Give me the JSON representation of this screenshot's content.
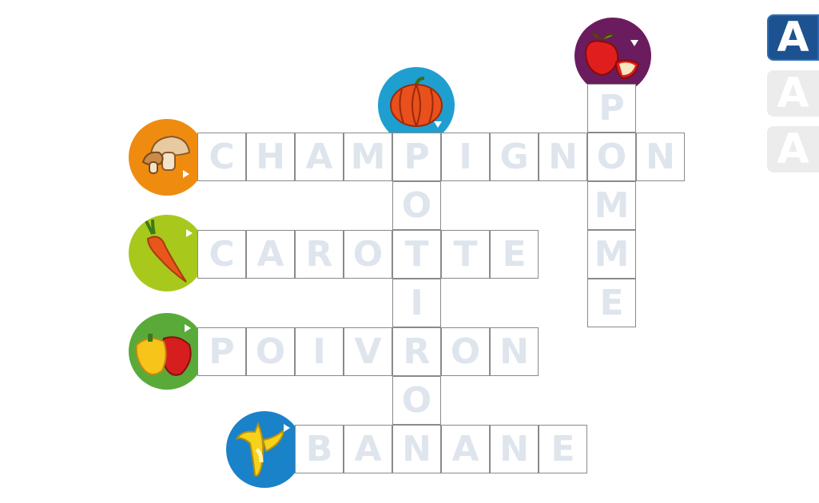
{
  "words": [
    {
      "id": "champignon",
      "answer": "CHAMPIGNON",
      "direction": "across",
      "clue_icon": "mushroom-icon",
      "clue_color": "#ef8c10"
    },
    {
      "id": "carotte",
      "answer": "CAROTTE",
      "direction": "across",
      "clue_icon": "carrot-icon",
      "clue_color": "#a8c81c"
    },
    {
      "id": "poivron",
      "answer": "POIVRON",
      "direction": "across",
      "clue_icon": "pepper-icon",
      "clue_color": "#5aaa3a"
    },
    {
      "id": "banane",
      "answer": "BANANE",
      "direction": "across",
      "clue_icon": "banana-icon",
      "clue_color": "#1a82c8"
    },
    {
      "id": "potiron",
      "answer": "POTIRON",
      "direction": "down",
      "clue_icon": "pumpkin-icon",
      "clue_color": "#1f9fd0"
    },
    {
      "id": "pomme",
      "answer": "POMME",
      "direction": "down",
      "clue_icon": "apple-icon",
      "clue_color": "#6b1c5e"
    }
  ],
  "level_buttons": [
    {
      "label": "A",
      "state": "selected"
    },
    {
      "label": "A",
      "state": "unselected"
    },
    {
      "label": "A",
      "state": "unselected"
    }
  ],
  "colors": {
    "letter": "#dfe5ed",
    "cell_border": "#8a8a8a",
    "level_active": "#1d5290",
    "level_inactive": "#ececec"
  }
}
